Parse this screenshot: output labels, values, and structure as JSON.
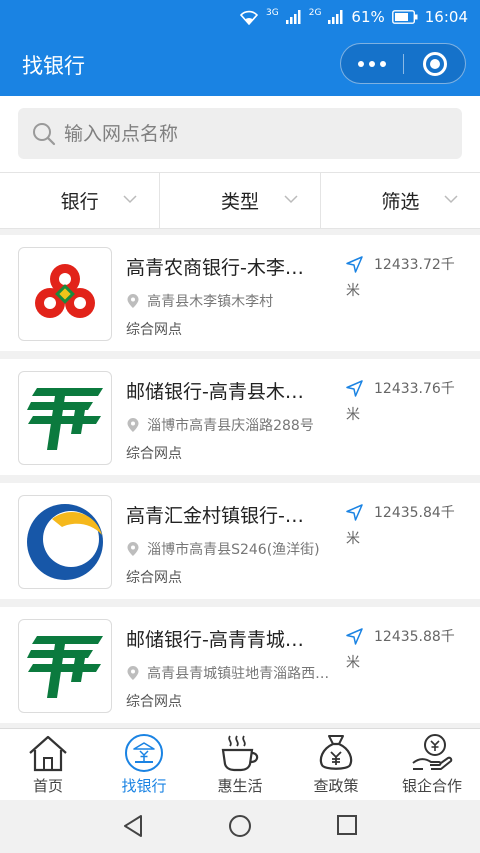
{
  "status_bar": {
    "network_1": "3G",
    "network_2": "2G",
    "battery": "61%",
    "time": "16:04"
  },
  "header": {
    "title": "找银行",
    "more_icon": "more-dots-icon",
    "close_icon": "mini-program-close-icon"
  },
  "search": {
    "placeholder": "输入网点名称"
  },
  "filters": [
    {
      "label": "银行"
    },
    {
      "label": "类型"
    },
    {
      "label": "筛选"
    }
  ],
  "branches": [
    {
      "name": "高青农商银行-木李…",
      "address": "高青县木李镇木李村",
      "type": "综合网点",
      "distance": "12433.72千",
      "unit": "米",
      "logo": "rural-commercial-bank-logo"
    },
    {
      "name": "邮储银行-高青县木…",
      "address": "淄博市高青县庆淄路288号",
      "type": "综合网点",
      "distance": "12433.76千",
      "unit": "米",
      "logo": "postal-savings-logo"
    },
    {
      "name": "高青汇金村镇银行-…",
      "address": "淄博市高青县S246(渔洋街)",
      "type": "综合网点",
      "distance": "12435.84千",
      "unit": "米",
      "logo": "huijin-village-bank-logo"
    },
    {
      "name": "邮储银行-高青青城…",
      "address": "高青县青城镇驻地青淄路西…",
      "type": "综合网点",
      "distance": "12435.88千",
      "unit": "米",
      "logo": "postal-savings-logo"
    }
  ],
  "tabs": [
    {
      "label": "首页",
      "icon": "home-icon"
    },
    {
      "label": "找银行",
      "icon": "bank-icon",
      "active": true
    },
    {
      "label": "惠生活",
      "icon": "coffee-icon"
    },
    {
      "label": "查政策",
      "icon": "money-bag-icon"
    },
    {
      "label": "银企合作",
      "icon": "hand-coin-icon"
    }
  ],
  "colors": {
    "primary": "#1a83e3",
    "postal_green": "#0b7a3e",
    "rural_red": "#e2231a",
    "huijin_blue": "#1757a8",
    "huijin_yellow": "#f5b81c"
  }
}
